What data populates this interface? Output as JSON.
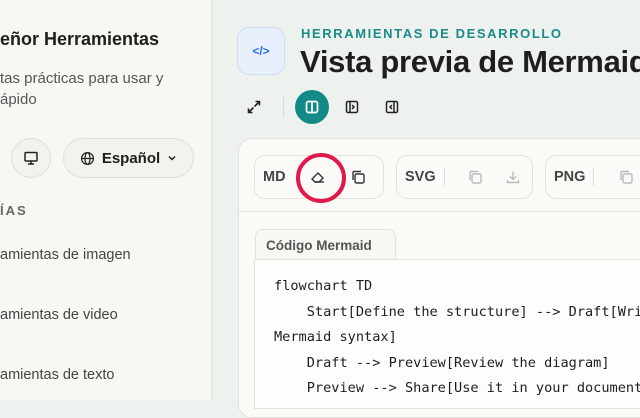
{
  "sidebar": {
    "title": "eñor Herramientas",
    "subtitle": [
      "tas prácticas para usar y",
      "ápido"
    ],
    "language": "Español",
    "section": "ÍAS",
    "items": [
      "amientas de imagen",
      "amientas de video",
      "amientas de texto"
    ]
  },
  "header": {
    "overline": "HERRAMIENTAS DE DESARROLLO",
    "title": "Vista previa de Mermaid"
  },
  "toolbar": {
    "md": "MD",
    "svg": "SVG",
    "png": "PNG"
  },
  "editor": {
    "tab": "Código Mermaid",
    "lines": [
      "flowchart TD",
      "    Start[Define the structure] --> Draft[Write",
      "Mermaid syntax]",
      "    Draft --> Preview[Review the diagram]",
      "    Preview --> Share[Use it in your documents]"
    ]
  },
  "colors": {
    "accent": "#1a8a8a",
    "highlight": "#e0194a"
  }
}
